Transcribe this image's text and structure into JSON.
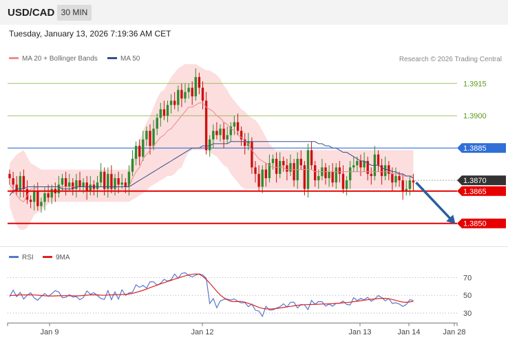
{
  "header": {
    "symbol": "USD/CAD",
    "interval": "30 MIN"
  },
  "timestamp": "Tuesday, January 13, 2026 7:19:36 AM CET",
  "legend": {
    "ma20_label": "MA 20 + Bollinger Bands",
    "ma50_label": "MA 50",
    "copyright": "Research © 2026 Trading Central"
  },
  "rsi_legend": {
    "rsi_label": "RSI",
    "ma_label": "9MA"
  },
  "colors": {
    "up": "#2e8b2e",
    "down": "#cc1111",
    "bollinger": "#fbd3d3",
    "ma20": "#e98a8a",
    "ma50": "#334f8c",
    "resistance": "#86b53e",
    "pivot": "#2f6fd6",
    "support": "#e60000",
    "price_tag": "#333333",
    "arrow": "#2a5d9f",
    "rsi": "#5577cc",
    "rsi_ma": "#dd2222"
  },
  "chart_data": [
    {
      "type": "candlestick",
      "ylim": [
        1.384,
        1.3925
      ],
      "x_ticks": [
        "Jan 9",
        "Jan 12",
        "Jan 13",
        "Jan 14",
        "Jan 28"
      ],
      "levels": [
        {
          "value": 1.3915,
          "label": "1.3915",
          "kind": "resistance"
        },
        {
          "value": 1.39,
          "label": "1.3900",
          "kind": "resistance"
        },
        {
          "value": 1.3885,
          "label": "1.3885",
          "kind": "pivot"
        },
        {
          "value": 1.387,
          "label": "1.3870",
          "kind": "last"
        },
        {
          "value": 1.3865,
          "label": "1.3865",
          "kind": "support"
        },
        {
          "value": 1.385,
          "label": "1.3850",
          "kind": "support"
        }
      ],
      "forecast": {
        "from": 1.3869,
        "to": 1.385,
        "direction": "down"
      },
      "close": [
        1.3871,
        1.3868,
        1.3865,
        1.3872,
        1.3866,
        1.3861,
        1.386,
        1.3865,
        1.3858,
        1.386,
        1.3864,
        1.3862,
        1.3866,
        1.3864,
        1.3868,
        1.3871,
        1.3867,
        1.3869,
        1.3866,
        1.387,
        1.3867,
        1.3869,
        1.3865,
        1.3868,
        1.3866,
        1.3869,
        1.3874,
        1.3866,
        1.3873,
        1.3866,
        1.3871,
        1.3868,
        1.3869,
        1.3867,
        1.3874,
        1.388,
        1.3886,
        1.3881,
        1.3889,
        1.3893,
        1.3886,
        1.3894,
        1.3899,
        1.3903,
        1.39,
        1.3905,
        1.3907,
        1.3905,
        1.3912,
        1.3908,
        1.3911,
        1.3913,
        1.3909,
        1.3918,
        1.3913,
        1.3907,
        1.3884,
        1.3889,
        1.3893,
        1.3891,
        1.3894,
        1.3889,
        1.3891,
        1.3895,
        1.3897,
        1.3893,
        1.3889,
        1.3886,
        1.3888,
        1.3876,
        1.3873,
        1.3867,
        1.3875,
        1.3871,
        1.3878,
        1.388,
        1.3873,
        1.3879,
        1.3877,
        1.3874,
        1.3878,
        1.387,
        1.388,
        1.3877,
        1.3866,
        1.3884,
        1.3877,
        1.387,
        1.3872,
        1.3876,
        1.3871,
        1.3874,
        1.3869,
        1.3876,
        1.3873,
        1.3866,
        1.387,
        1.3876,
        1.3877,
        1.3879,
        1.3876,
        1.3879,
        1.3873,
        1.3872,
        1.3882,
        1.3877,
        1.3872,
        1.3877,
        1.3873,
        1.3869,
        1.3872,
        1.387,
        1.3865,
        1.3866,
        1.387,
        1.3869
      ],
      "ma20": [
        1.3868,
        1.3866,
        1.3863,
        1.3861,
        1.386,
        1.3863,
        1.3866,
        1.3866,
        1.3867,
        1.3867,
        1.3867,
        1.3867,
        1.3867,
        1.3867,
        1.3867,
        1.3867,
        1.3867,
        1.3867,
        1.3867,
        1.3867,
        1.3867,
        1.3867,
        1.3867,
        1.3867,
        1.3867,
        1.3867,
        1.3867,
        1.3867,
        1.3867,
        1.3867,
        1.3867,
        1.3867,
        1.3867,
        1.3867,
        1.3867,
        1.3871,
        1.3874,
        1.3876,
        1.388,
        1.3882,
        1.3884,
        1.3886,
        1.3888,
        1.389,
        1.3891,
        1.3893,
        1.3894,
        1.3896,
        1.3898,
        1.39,
        1.3902,
        1.3904,
        1.3904,
        1.3905,
        1.3906,
        1.3906,
        1.3904,
        1.3903,
        1.3902,
        1.39,
        1.3899,
        1.3897,
        1.3896,
        1.3894,
        1.3893,
        1.3891,
        1.389,
        1.3888,
        1.3887,
        1.3884,
        1.3882,
        1.388,
        1.3879,
        1.3878,
        1.3877,
        1.3876,
        1.3876,
        1.3876,
        1.3876,
        1.3875,
        1.3875,
        1.3875,
        1.3875,
        1.3875,
        1.3875,
        1.3875,
        1.3875,
        1.3874,
        1.3874,
        1.3874,
        1.3874,
        1.3874,
        1.3874,
        1.3874,
        1.3874,
        1.3874,
        1.3874,
        1.3874,
        1.3874,
        1.3874,
        1.3874,
        1.3874,
        1.3874,
        1.3874,
        1.3874,
        1.3874,
        1.3874,
        1.3874,
        1.3874,
        1.3873,
        1.3873,
        1.3873,
        1.3872,
        1.3872,
        1.3872,
        1.3872
      ],
      "bb_upper": [
        1.3878,
        1.388,
        1.3882,
        1.3883,
        1.3884,
        1.3881,
        1.3878,
        1.3877,
        1.3876,
        1.3875,
        1.3875,
        1.3875,
        1.3875,
        1.3875,
        1.3875,
        1.3875,
        1.3875,
        1.3875,
        1.3875,
        1.3875,
        1.3875,
        1.3875,
        1.3875,
        1.3875,
        1.3875,
        1.3875,
        1.3875,
        1.3875,
        1.3875,
        1.3875,
        1.3875,
        1.3875,
        1.3875,
        1.3875,
        1.3875,
        1.388,
        1.3885,
        1.3888,
        1.3893,
        1.3897,
        1.39,
        1.3904,
        1.3908,
        1.3911,
        1.3912,
        1.3915,
        1.3918,
        1.392,
        1.3922,
        1.3923,
        1.3924,
        1.3924,
        1.3924,
        1.3924,
        1.3923,
        1.3922,
        1.3921,
        1.3921,
        1.392,
        1.3919,
        1.3917,
        1.3914,
        1.3912,
        1.3909,
        1.3907,
        1.3905,
        1.3903,
        1.3902,
        1.39,
        1.3899,
        1.3898,
        1.3896,
        1.3893,
        1.389,
        1.3887,
        1.3885,
        1.3884,
        1.3884,
        1.3884,
        1.3884,
        1.3884,
        1.3884,
        1.3884,
        1.3884,
        1.3884,
        1.3884,
        1.3884,
        1.3884,
        1.3884,
        1.3884,
        1.3884,
        1.3884,
        1.3884,
        1.3884,
        1.3884,
        1.3884,
        1.3884,
        1.3884,
        1.3884,
        1.3884,
        1.3884,
        1.3884,
        1.3884,
        1.3884,
        1.3884,
        1.3884,
        1.3884,
        1.3884,
        1.3884,
        1.3884,
        1.3884,
        1.3884,
        1.3884,
        1.3884,
        1.3884,
        1.3884
      ],
      "bb_lower": [
        1.3858,
        1.3853,
        1.3849,
        1.3847,
        1.3847,
        1.3848,
        1.3851,
        1.3854,
        1.3855,
        1.3856,
        1.3858,
        1.3859,
        1.386,
        1.386,
        1.386,
        1.386,
        1.386,
        1.386,
        1.386,
        1.386,
        1.386,
        1.386,
        1.386,
        1.386,
        1.386,
        1.386,
        1.386,
        1.386,
        1.386,
        1.386,
        1.386,
        1.386,
        1.386,
        1.386,
        1.386,
        1.3861,
        1.3862,
        1.3863,
        1.3864,
        1.3865,
        1.3867,
        1.3868,
        1.3869,
        1.387,
        1.3871,
        1.3872,
        1.3872,
        1.3873,
        1.3875,
        1.3876,
        1.388,
        1.3883,
        1.3884,
        1.3884,
        1.3884,
        1.3884,
        1.3884,
        1.3883,
        1.3882,
        1.3881,
        1.3879,
        1.3877,
        1.3876,
        1.3873,
        1.3871,
        1.3869,
        1.3867,
        1.3866,
        1.3866,
        1.3866,
        1.3866,
        1.3866,
        1.3866,
        1.3866,
        1.3866,
        1.3866,
        1.3866,
        1.3866,
        1.3866,
        1.3866,
        1.3866,
        1.3866,
        1.3866,
        1.3866,
        1.3866,
        1.3866,
        1.3866,
        1.3866,
        1.3866,
        1.3866,
        1.3866,
        1.3866,
        1.3866,
        1.3866,
        1.3866,
        1.3866,
        1.3866,
        1.3866,
        1.3866,
        1.3866,
        1.3866,
        1.3866,
        1.3866,
        1.3866,
        1.3866,
        1.3866,
        1.3866,
        1.3866,
        1.3866,
        1.3866,
        1.3866,
        1.3866,
        1.3866,
        1.3866,
        1.3866,
        1.3866
      ],
      "ma50": [
        1.3863,
        1.3865,
        1.3866,
        1.3866,
        1.3866,
        1.3867,
        1.3867,
        1.3867,
        1.3867,
        1.3867,
        1.3867,
        1.3867,
        1.3867,
        1.3867,
        1.3867,
        1.3866,
        1.3866,
        1.3866,
        1.3866,
        1.3867,
        1.3867,
        1.3867,
        1.3867,
        1.3867,
        1.3867,
        1.3867,
        1.3867,
        1.3867,
        1.3867,
        1.3867,
        1.3867,
        1.3867,
        1.3867,
        1.3867,
        1.3867,
        1.3868,
        1.3869,
        1.387,
        1.3871,
        1.3872,
        1.3873,
        1.3874,
        1.3875,
        1.3876,
        1.3877,
        1.3878,
        1.3879,
        1.388,
        1.3881,
        1.3882,
        1.3883,
        1.3884,
        1.3885,
        1.3885,
        1.3885,
        1.3886,
        1.3886,
        1.3886,
        1.3887,
        1.3887,
        1.3887,
        1.3887,
        1.3887,
        1.3888,
        1.3888,
        1.3888,
        1.3888,
        1.3888,
        1.3888,
        1.3888,
        1.3888,
        1.3888,
        1.3888,
        1.3888,
        1.3888,
        1.3888,
        1.3888,
        1.3888,
        1.3888,
        1.3888,
        1.3888,
        1.3888,
        1.3888,
        1.3888,
        1.3888,
        1.3888,
        1.3888,
        1.3888,
        1.3887,
        1.3887,
        1.3886,
        1.3886,
        1.3885,
        1.3885,
        1.3884,
        1.3883,
        1.3883,
        1.3882,
        1.3881,
        1.388,
        1.3879,
        1.3879,
        1.3878,
        1.3877,
        1.3877,
        1.3877,
        1.3876,
        1.3875,
        1.3875,
        1.3874,
        1.3874,
        1.3873,
        1.3873,
        1.3872,
        1.3872,
        1.3871
      ]
    },
    {
      "type": "line",
      "ylim": [
        20,
        85
      ],
      "y_ticks": [
        30,
        50,
        70
      ],
      "series": [
        {
          "name": "RSI",
          "values": [
            48.5,
            55.9,
            48.5,
            53.3,
            45.8,
            50.1,
            52.8,
            46.9,
            44.5,
            48.8,
            52.0,
            48.7,
            51.8,
            55.3,
            53.7,
            47.3,
            47.7,
            50.7,
            48.0,
            48.5,
            45.1,
            47.5,
            55.0,
            51.2,
            52.9,
            49.8,
            46.4,
            45.4,
            55.4,
            45.1,
            53.9,
            45.8,
            56.2,
            50.0,
            52.7,
            53.5,
            61.8,
            59.0,
            61.2,
            58.1,
            65.3,
            65.1,
            61.5,
            63.5,
            67.9,
            66.0,
            67.6,
            73.9,
            69.1,
            74.6,
            75.4,
            72.4,
            70.8,
            72.7,
            74.1,
            72.9,
            69.1,
            40.7,
            46.4,
            36.0,
            43.7,
            45.4,
            45.6,
            44.8,
            45.9,
            43.2,
            41.4,
            41.9,
            37.2,
            40.2,
            33.2,
            32.3,
            26.3,
            37.6,
            33.3,
            33.6,
            35.6,
            37.0,
            40.4,
            36.7,
            42.2,
            42.3,
            35.7,
            39.8,
            39.1,
            33.9,
            44.3,
            40.0,
            42.9,
            42.8,
            37.8,
            40.1,
            37.7,
            41.0,
            41.0,
            43.6,
            39.7,
            39.2,
            47.3,
            44.1,
            46.5,
            44.9,
            47.7,
            43.3,
            45.9,
            49.7,
            47.5,
            43.8,
            46.5,
            40.8,
            41.6,
            40.2,
            37.5,
            39.7,
            45.0,
            44.2
          ]
        },
        {
          "name": "9MA",
          "values": [
            49.8,
            49.9,
            50.2,
            50.4,
            50.5,
            50.5,
            50.5,
            50.4,
            50.2,
            49.8,
            49.5,
            49.3,
            49.2,
            49.3,
            49.5,
            49.5,
            49.6,
            49.5,
            49.4,
            49.3,
            49.5,
            49.8,
            50.2,
            50.5,
            50.6,
            50.5,
            50.2,
            50.0,
            50.3,
            50.5,
            50.7,
            50.8,
            50.8,
            51.0,
            51.4,
            52.2,
            53.3,
            54.4,
            55.6,
            57.0,
            58.6,
            60.0,
            61.4,
            62.9,
            64.3,
            65.6,
            66.8,
            68.2,
            69.5,
            70.8,
            71.9,
            72.9,
            73.6,
            74.0,
            73.8,
            71.4,
            67.8,
            63.8,
            59.1,
            54.5,
            50.3,
            47.3,
            45.0,
            43.3,
            42.8,
            43.1,
            43.0,
            42.3,
            41.0,
            39.6,
            38.0,
            36.4,
            35.3,
            34.7,
            34.6,
            34.8,
            35.2,
            35.7,
            36.3,
            37.0,
            37.6,
            38.2,
            38.8,
            39.2,
            39.5,
            39.6,
            39.7,
            39.8,
            40.0,
            40.2,
            40.3,
            40.4,
            40.6,
            40.9,
            41.2,
            41.6,
            41.9,
            42.3,
            42.8,
            43.3,
            43.9,
            44.5,
            45.0,
            45.5,
            45.9,
            46.3,
            46.6,
            46.6,
            46.1,
            45.3,
            44.3,
            43.3,
            42.4,
            42.1,
            42.5,
            43.2
          ]
        }
      ]
    }
  ]
}
